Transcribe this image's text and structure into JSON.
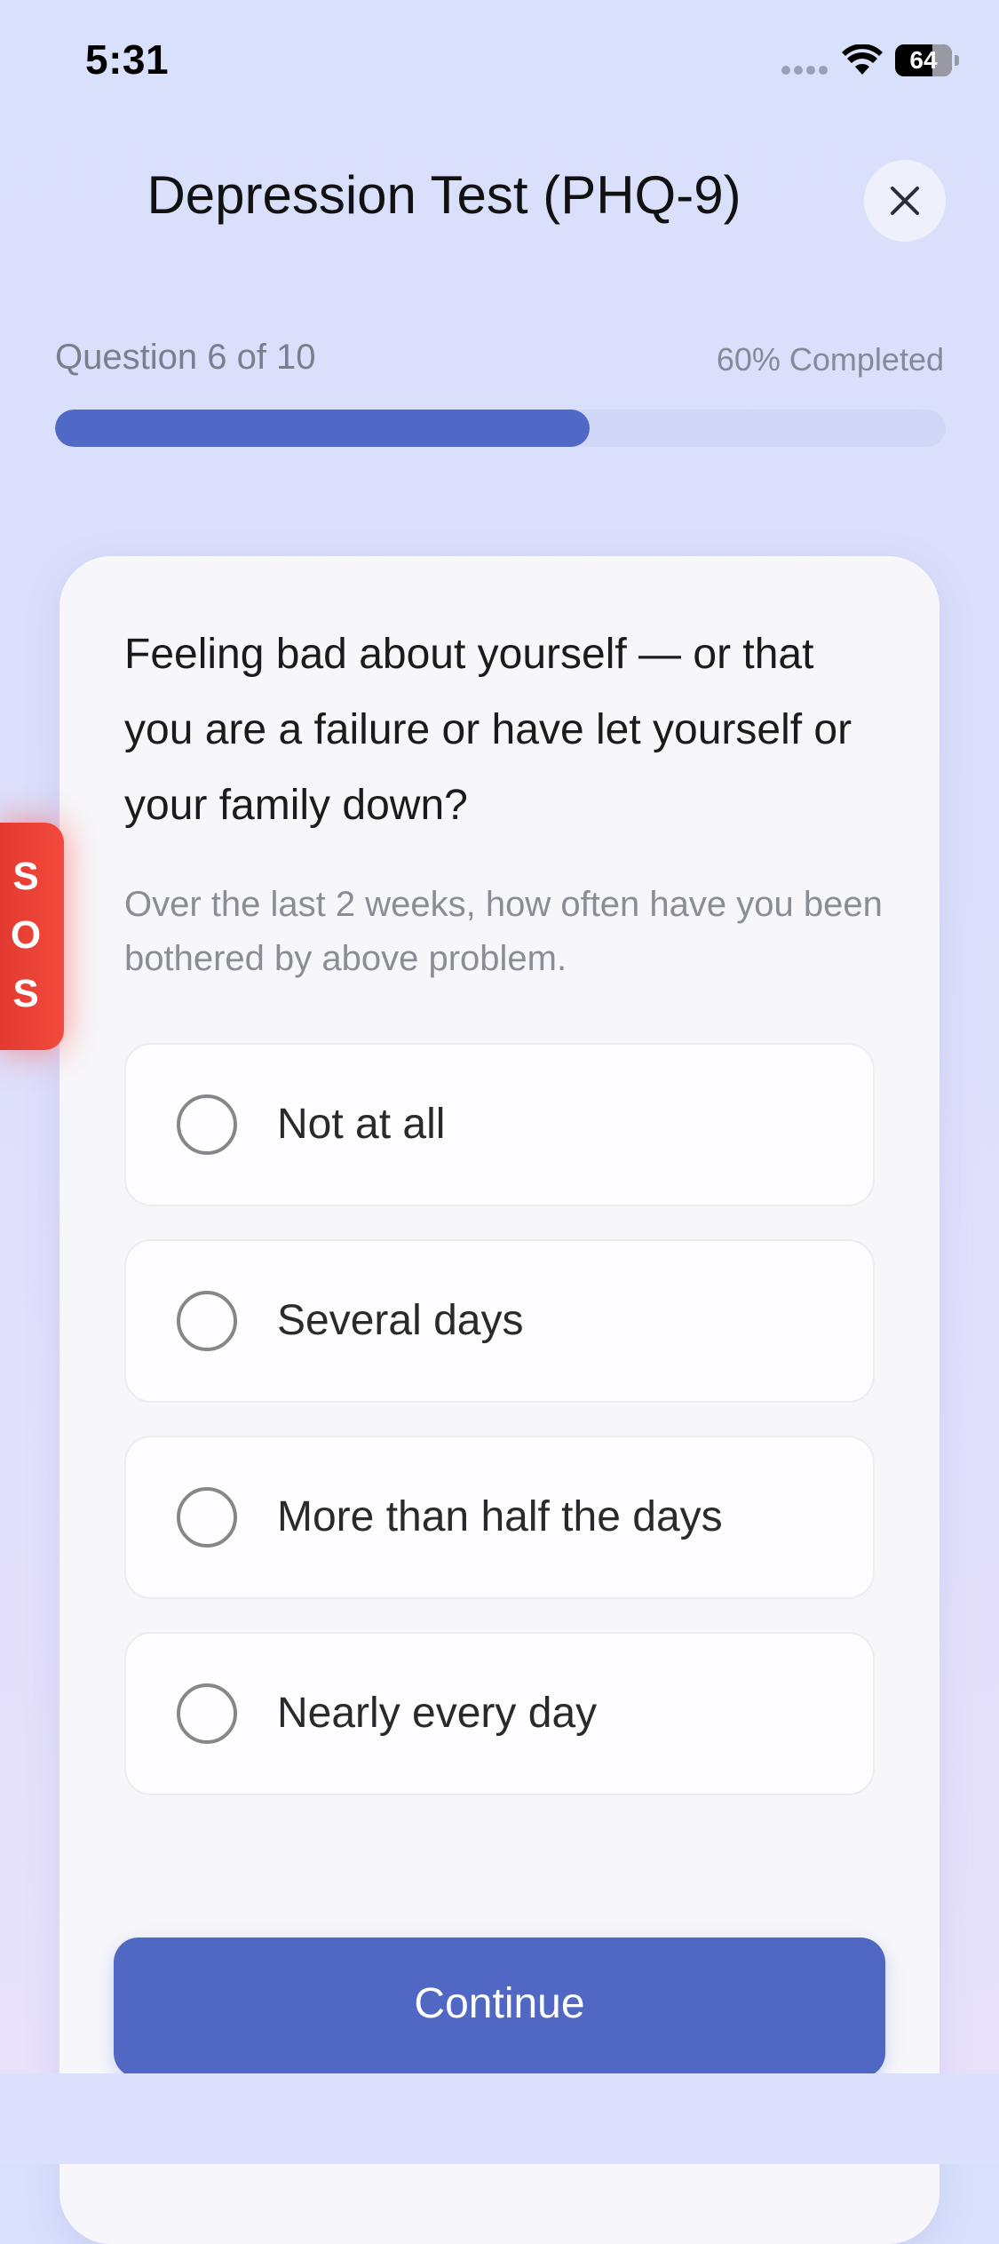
{
  "status_bar": {
    "time": "5:31",
    "battery_level": "64"
  },
  "header": {
    "title": "Depression Test (PHQ-9)",
    "close_icon": "close-icon"
  },
  "progress": {
    "label": "Question 6 of 10",
    "percent_text": "60% Completed",
    "fraction": 0.6,
    "fill_color": "#5069c7",
    "track_color": "#d1d7f8"
  },
  "question": {
    "text": "Feeling bad about yourself — or that you are a failure or have let yourself or your family down?",
    "hint": "Over the last 2 weeks, how often have you been bothered by above problem."
  },
  "options": [
    {
      "label": "Not at all",
      "selected": false
    },
    {
      "label": "Several days",
      "selected": false
    },
    {
      "label": "More than half the days",
      "selected": false
    },
    {
      "label": "Nearly every day",
      "selected": false
    }
  ],
  "continue_button": {
    "label": "Continue",
    "color": "#5068c4"
  },
  "sos": {
    "letters": [
      "S",
      "O",
      "S"
    ],
    "color": "#e8402f"
  }
}
